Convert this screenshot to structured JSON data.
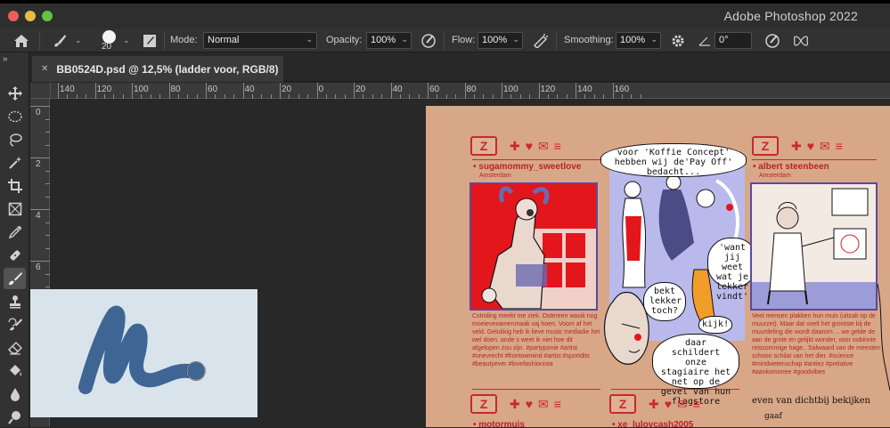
{
  "app": {
    "title": "Adobe Photoshop 2022"
  },
  "options": {
    "brush_size": "20",
    "mode_label": "Mode:",
    "mode_value": "Normal",
    "opacity_label": "Opacity:",
    "opacity_value": "100%",
    "flow_label": "Flow:",
    "flow_value": "100%",
    "smoothing_label": "Smoothing:",
    "smoothing_value": "100%",
    "angle_value": "0°"
  },
  "document": {
    "tab_title": "BB0524D.psd @ 12,5% (ladder voor, RGB/8)"
  },
  "rulers": {
    "h_ticks": [
      "140",
      "120",
      "100",
      "80",
      "60",
      "40",
      "20",
      "0",
      "20",
      "40",
      "60",
      "80",
      "100",
      "120",
      "140",
      "160"
    ],
    "v_ticks": [
      "0",
      "2",
      "4",
      "6"
    ]
  },
  "artwork": {
    "profile1": {
      "name": "• sugamommy_sweetlove",
      "city": "Amsterdam",
      "caption": "Cstroling meekt me ziek. Ostereen wasik nog moeievexamenmaak vaj hoen. Voom af het veld. Gelukkig heb ik lieve music mediadie het wel doen. ande s weet ik niet hoe dit afgelopen zou zijn. #partyponie #artist #onevrecht #frontowmind #artist #sportdits #beautyever #lovefashionista"
    },
    "profile2": {
      "name": "• albert steenbeen",
      "city": "Amsterdam",
      "caption": "Veel mensen plakken hun muis (uitzak op de muurzet). Maar dat voelt het grootste bij de muurdeling die wordt daarom ... we gelde de aan de grote en gelijkt wonder, voor oobinnie reissommige hage.. Salwaard van de meesten schoon schilat van het dier. #science #mindwetenschap #antiez #prelative #aankomonee #goodvibes"
    },
    "profile3": {
      "name": "• motormuis"
    },
    "profile4": {
      "name": "• xe_lulovcash2005"
    },
    "bubble_top": "voor 'Koffie Concept' hebben wij de'Pay Off' bedacht...",
    "bubble_want": "'want jij weet wat je lekker vindt'",
    "bubble_bekt": "bekt lekker toch?",
    "bubble_kijk": "kijk!",
    "bubble_daar": "daar schildert onze stagiaire het net op de gevel van hun flagstore",
    "hand1": "even van dichtbij bekijken",
    "hand2": "gaaf"
  },
  "colors": {
    "accent_red": "#c8292c",
    "paper": "#d8a787",
    "brush_stroke": "#3e6593"
  }
}
